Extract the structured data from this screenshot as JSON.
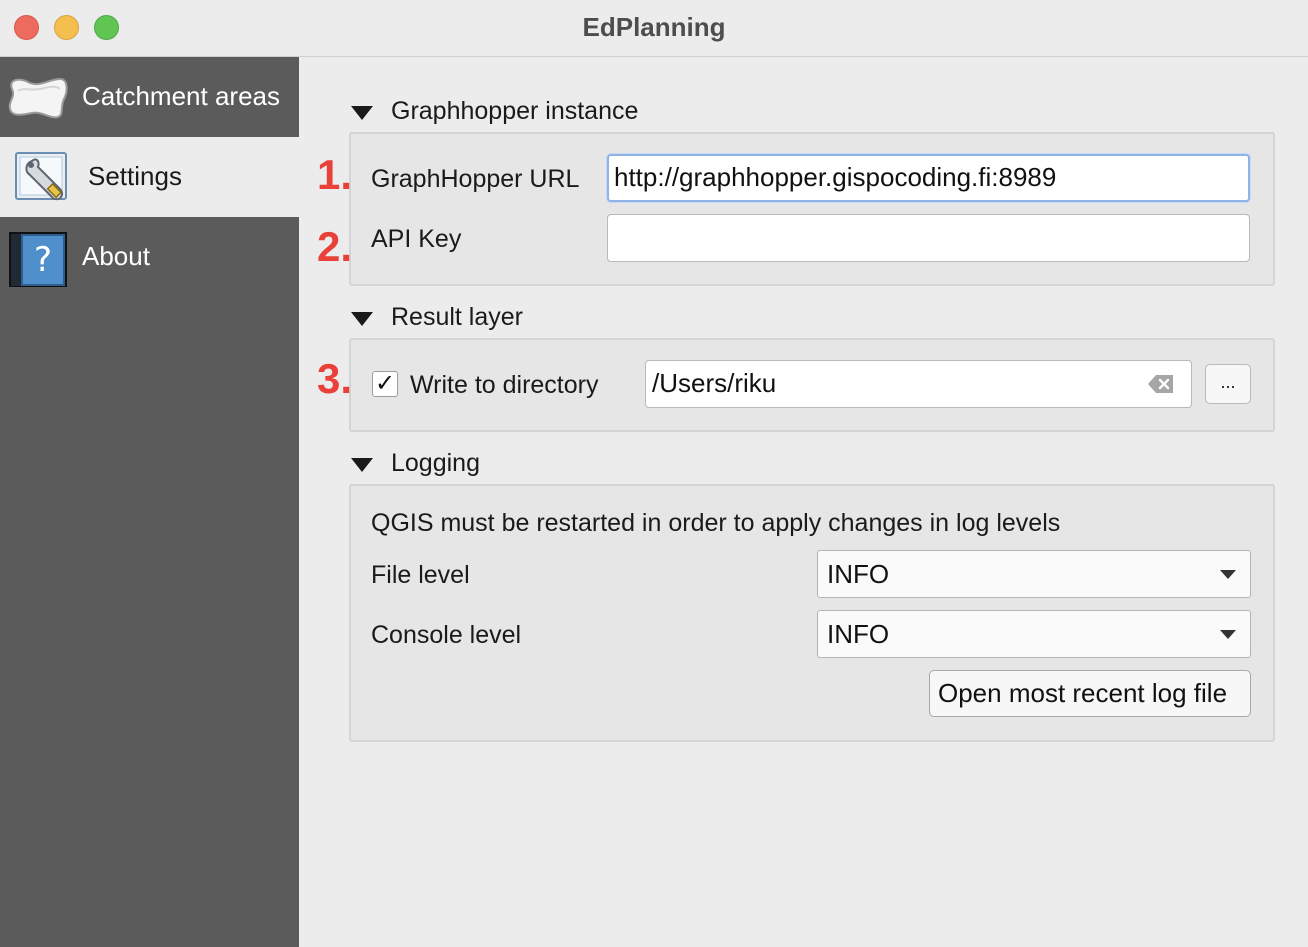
{
  "window": {
    "title": "EdPlanning"
  },
  "sidebar": {
    "items": [
      {
        "label": "Catchment areas",
        "icon": "catchment-shape-icon",
        "active": false
      },
      {
        "label": "Settings",
        "icon": "wrench-settings-icon",
        "active": true
      },
      {
        "label": "About",
        "icon": "help-book-icon",
        "active": false
      }
    ]
  },
  "annotations": {
    "one": "1.",
    "two": "2.",
    "three": "3.",
    "color": "#e9403a"
  },
  "sections": {
    "graphhopper": {
      "title": "Graphhopper instance",
      "url_label": "GraphHopper URL",
      "url_value": "http://graphhopper.gispocoding.fi:8989",
      "api_key_label": "API Key",
      "api_key_value": ""
    },
    "result_layer": {
      "title": "Result layer",
      "write_label": "Write to directory",
      "write_checked": true,
      "check_mark": "✓",
      "directory_value": "/Users/riku",
      "browse_label": "..."
    },
    "logging": {
      "title": "Logging",
      "notice": "QGIS must be restarted in order to apply changes in log levels",
      "file_level_label": "File level",
      "file_level_value": "INFO",
      "console_level_label": "Console level",
      "console_level_value": "INFO",
      "open_log_label": "Open most recent log file"
    }
  },
  "colors": {
    "sidebar_bg": "#5b5b5b",
    "content_bg": "#ececec",
    "focus_border": "#8fb3e8"
  }
}
